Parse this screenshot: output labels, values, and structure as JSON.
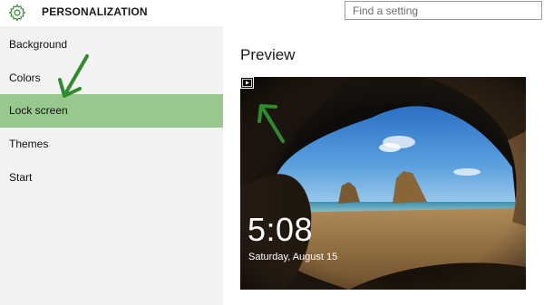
{
  "header": {
    "title": "PERSONALIZATION",
    "icon": "gear-icon",
    "search_placeholder": "Find a setting"
  },
  "sidebar": {
    "items": [
      {
        "label": "Background",
        "selected": false
      },
      {
        "label": "Colors",
        "selected": false
      },
      {
        "label": "Lock screen",
        "selected": true
      },
      {
        "label": "Themes",
        "selected": false
      },
      {
        "label": "Start",
        "selected": false
      }
    ],
    "selected_color": "#99c88f"
  },
  "main": {
    "title": "Preview",
    "preview": {
      "time": "5:08",
      "date": "Saturday, August 15",
      "icon": "slideshow-icon"
    }
  },
  "annotations": {
    "arrow_color": "#2e8b2e"
  }
}
